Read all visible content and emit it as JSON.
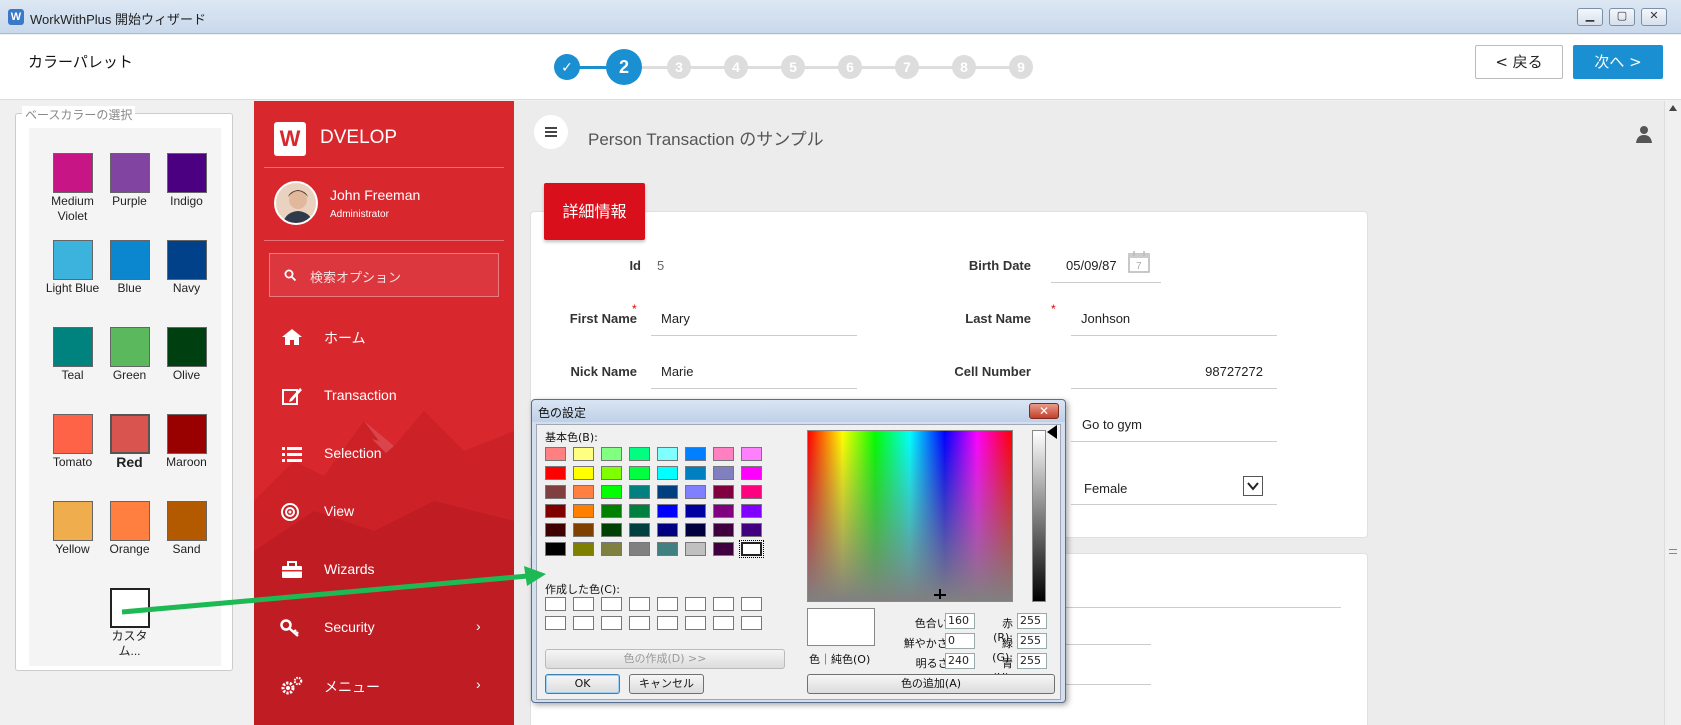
{
  "window": {
    "title": "WorkWithPlus 開始ウィザード",
    "icon": "W",
    "controls": [
      "minimize",
      "maximize",
      "close"
    ]
  },
  "wizard": {
    "page_title": "カラーパレット",
    "current_step": 2,
    "total_steps": 9,
    "steps": [
      "✓",
      "2",
      "3",
      "4",
      "5",
      "6",
      "7",
      "8",
      "9"
    ],
    "back_label": "< 戻る",
    "next_label": "次へ >"
  },
  "base_colors": {
    "legend": "ベースカラーの選択",
    "swatches": [
      {
        "label": "Medium Violet",
        "color": "#c71585"
      },
      {
        "label": "Purple",
        "color": "#8144a0"
      },
      {
        "label": "Indigo",
        "color": "#4b0082"
      },
      {
        "label": "Light Blue",
        "color": "#3cb3dd"
      },
      {
        "label": "Blue",
        "color": "#0b87d0"
      },
      {
        "label": "Navy",
        "color": "#00418a"
      },
      {
        "label": "Teal",
        "color": "#00827f"
      },
      {
        "label": "Green",
        "color": "#5cb85c"
      },
      {
        "label": "Olive",
        "color": "#004010"
      },
      {
        "label": "Tomato",
        "color": "#ff6347"
      },
      {
        "label": "Red",
        "color": "#d9534f",
        "selected": true
      },
      {
        "label": "Maroon",
        "color": "#990000"
      },
      {
        "label": "Yellow",
        "color": "#f0ad4e"
      },
      {
        "label": "Orange",
        "color": "#ff7f41"
      },
      {
        "label": "Sand",
        "color": "#b35900"
      },
      {
        "label": "カスタム...",
        "color": "#ffffff"
      }
    ]
  },
  "app": {
    "brand": "DVELOP",
    "logo": "W",
    "user_name": "John Freeman",
    "user_role": "Administrator",
    "search_placeholder": "検索オプション",
    "accent": "#d9272e",
    "menu": [
      {
        "label": "ホーム",
        "icon": "home-icon",
        "chevron": false
      },
      {
        "label": "Transaction",
        "icon": "edit-icon",
        "chevron": false
      },
      {
        "label": "Selection",
        "icon": "list-icon",
        "chevron": false
      },
      {
        "label": "View",
        "icon": "target-icon",
        "chevron": false
      },
      {
        "label": "Wizards",
        "icon": "briefcase-icon",
        "chevron": false
      },
      {
        "label": "Security",
        "icon": "key-icon",
        "chevron": true
      },
      {
        "label": "メニュー",
        "icon": "gears-icon",
        "chevron": true
      }
    ],
    "chevron": "›",
    "page_title": "Person Transaction のサンプル",
    "tab": "詳細情報",
    "fields": {
      "id_label": "Id",
      "id_value": "5",
      "birth_label": "Birth Date",
      "birth_value": "05/09/87",
      "first_label": "First Name",
      "first_value": "Mary",
      "last_label": "Last Name",
      "last_value": "Jonhson",
      "nick_label": "Nick Name",
      "nick_value": "Marie",
      "cell_label": "Cell Number",
      "cell_value": "98727272",
      "hobby_value": "Go to gym",
      "gender_value": "Female"
    },
    "required_mark": "*"
  },
  "color_dialog": {
    "title": "色の設定",
    "close": "✕",
    "basic_label": "基本色(B):",
    "custom_label": "作成した色(C):",
    "define_button": "色の作成(D) >>",
    "ok": "OK",
    "cancel": "キャンセル",
    "solid_label": "色｜純色(O)",
    "hue_label": "色合い(E):",
    "hue": "160",
    "sat_label": "鮮やかさ(S):",
    "sat": "0",
    "lum_label": "明るさ(L):",
    "lum": "240",
    "red_label": "赤(R):",
    "red": "255",
    "green_label": "緑(G):",
    "green": "255",
    "blue_label": "青(U):",
    "blue": "255",
    "add_button": "色の追加(A)",
    "basic_colors": [
      "#ff8080",
      "#ffff80",
      "#80ff80",
      "#00ff80",
      "#80ffff",
      "#0080ff",
      "#ff80c0",
      "#ff80ff",
      "#ff0000",
      "#ffff00",
      "#80ff00",
      "#00ff40",
      "#00ffff",
      "#0080c0",
      "#8080c0",
      "#ff00ff",
      "#804040",
      "#ff8040",
      "#00ff00",
      "#008080",
      "#004080",
      "#8080ff",
      "#800040",
      "#ff0080",
      "#800000",
      "#ff8000",
      "#008000",
      "#008040",
      "#0000ff",
      "#0000a0",
      "#800080",
      "#8000ff",
      "#400000",
      "#804000",
      "#004000",
      "#004040",
      "#000080",
      "#000040",
      "#400040",
      "#400080",
      "#000000",
      "#808000",
      "#808040",
      "#808080",
      "#408080",
      "#c0c0c0",
      "#400040",
      "#ffffff"
    ]
  }
}
